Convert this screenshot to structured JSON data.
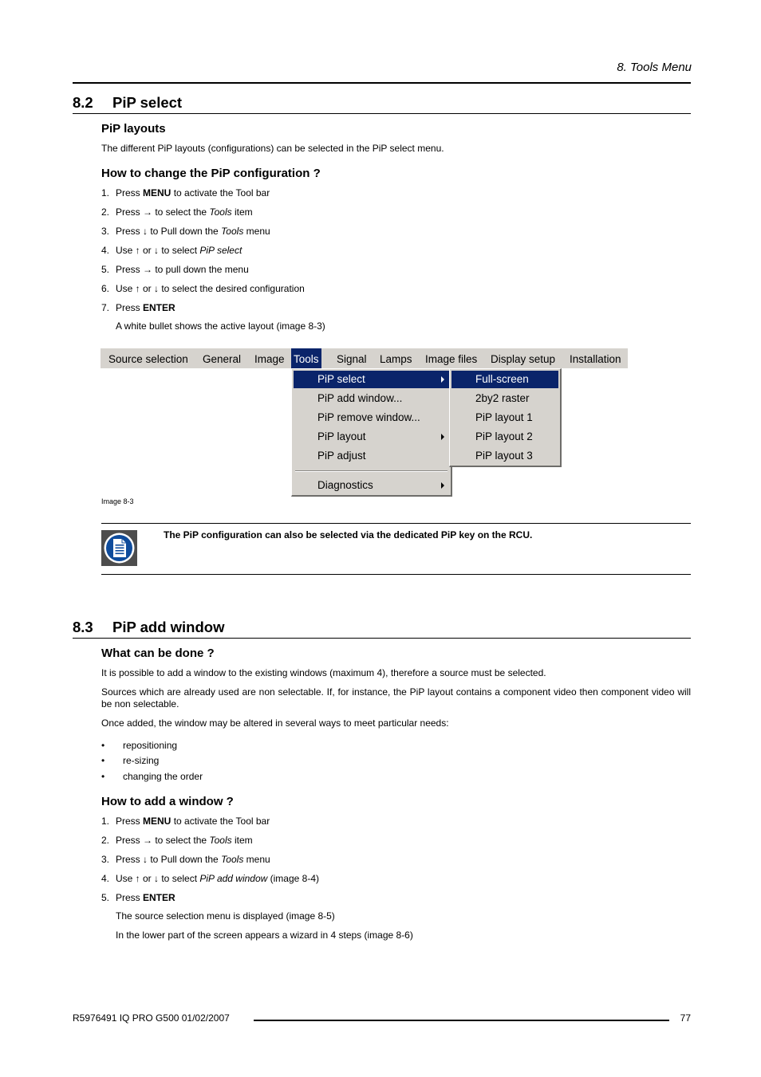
{
  "running_head": "8.  Tools Menu",
  "section_82": {
    "number": "8.2",
    "title": "PiP select",
    "sub1": {
      "heading": "PiP layouts",
      "text": "The different PiP layouts (configurations) can be selected in the PiP select menu."
    },
    "sub2": {
      "heading": "How to change the PiP configuration ?",
      "steps": [
        {
          "n": "1.",
          "a": "Press ",
          "b": "MENU",
          "c": " to activate the Tool bar"
        },
        {
          "n": "2.",
          "a": "Press → to select the ",
          "i": "Tools",
          "c": " item"
        },
        {
          "n": "3.",
          "a": "Press ↓ to Pull down the ",
          "i": "Tools",
          "c": " menu"
        },
        {
          "n": "4.",
          "a": "Use ↑ or ↓ to select ",
          "i": "PiP select",
          "c": ""
        },
        {
          "n": "5.",
          "a": "Press → to pull down the menu",
          "c": ""
        },
        {
          "n": "6.",
          "a": "Use ↑ or ↓ to select the desired configuration",
          "c": ""
        },
        {
          "n": "7.",
          "a": "Press ",
          "b": "ENTER",
          "c": ""
        }
      ],
      "after": "A white bullet shows the active layout (image 8-3)"
    },
    "screenshot": {
      "menubar": [
        "Source selection",
        "General",
        "Image",
        "Tools",
        "Signal",
        "Lamps",
        "Image files",
        "Display setup",
        "Installation"
      ],
      "active_menu": "Tools",
      "tools_menu": [
        {
          "label": "PiP select",
          "submenu": true,
          "selected": true
        },
        {
          "label": "PiP add window...",
          "submenu": false
        },
        {
          "label": "PiP remove window...",
          "submenu": false
        },
        {
          "label": "PiP layout",
          "submenu": true
        },
        {
          "label": "PiP adjust",
          "submenu": false
        },
        {
          "label": "Diagnostics",
          "submenu": true
        }
      ],
      "pip_select_menu": [
        {
          "label": "Full-screen",
          "selected": true
        },
        {
          "label": "2by2 raster"
        },
        {
          "label": "PiP layout 1"
        },
        {
          "label": "PiP layout 2"
        },
        {
          "label": "PiP layout 3"
        }
      ],
      "caption": "Image 8-3",
      "colors": {
        "menu_bg": "#d6d3ce",
        "highlight": "#0a246a"
      }
    },
    "note": "The PiP configuration can also be selected via the dedicated PiP key on the RCU."
  },
  "section_83": {
    "number": "8.3",
    "title": "PiP add window",
    "sub1": {
      "heading": "What can be done ?",
      "p1": "It is possible to add a window to the existing windows (maximum 4), therefore a source must be selected.",
      "p2": "Sources which are already used are non selectable.  If, for instance, the PiP layout contains a component video then component video will be non selectable.",
      "p3": "Once added, the window may be altered in several ways to meet particular needs:",
      "bullets": [
        "repositioning",
        "re-sizing",
        "changing the order"
      ]
    },
    "sub2": {
      "heading": "How to add a window ?",
      "steps": [
        {
          "n": "1.",
          "a": "Press ",
          "b": "MENU",
          "c": " to activate the Tool bar"
        },
        {
          "n": "2.",
          "a": "Press → to select the ",
          "i": "Tools",
          "c": " item"
        },
        {
          "n": "3.",
          "a": "Press ↓ to Pull down the ",
          "i": "Tools",
          "c": " menu"
        },
        {
          "n": "4.",
          "a": "Use ↑ or ↓ to select ",
          "i": "PiP add window",
          "c": " (image 8-4)"
        },
        {
          "n": "5.",
          "a": "Press ",
          "b": "ENTER",
          "c": ""
        }
      ],
      "after1": "The source selection menu is displayed (image 8-5)",
      "after2": "In the lower part of the screen appears a wizard in 4 steps (image 8-6)"
    }
  },
  "footer": {
    "doc": "R5976491   IQ PRO G500  01/02/2007",
    "page": "77"
  }
}
